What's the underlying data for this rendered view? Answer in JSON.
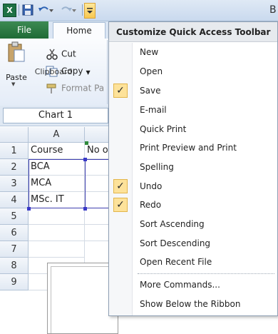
{
  "title_bar": {
    "app_title_partial": "B"
  },
  "ribbon": {
    "tabs": {
      "file": "File",
      "home": "Home"
    },
    "clipboard": {
      "paste": "Paste",
      "cut": "Cut",
      "copy": "Copy",
      "format_painter": "Format Pa",
      "group_label": "Clipboard"
    }
  },
  "name_box": {
    "value": "Chart 1"
  },
  "grid": {
    "columns": [
      "A"
    ],
    "rows": [
      "1",
      "2",
      "3",
      "4",
      "5",
      "6",
      "7",
      "8",
      "9"
    ],
    "cells": {
      "A1": "Course",
      "B1": "No o",
      "A2": "BCA",
      "A3": "MCA",
      "A4": "MSc. IT"
    }
  },
  "qat_menu": {
    "header": "Customize Quick Access Toolbar",
    "items": [
      {
        "label": "New",
        "checked": false
      },
      {
        "label": "Open",
        "checked": false
      },
      {
        "label": "Save",
        "checked": true
      },
      {
        "label": "E-mail",
        "checked": false
      },
      {
        "label": "Quick Print",
        "checked": false
      },
      {
        "label": "Print Preview and Print",
        "checked": false
      },
      {
        "label": "Spelling",
        "checked": false
      },
      {
        "label": "Undo",
        "checked": true
      },
      {
        "label": "Redo",
        "checked": true
      },
      {
        "label": "Sort Ascending",
        "checked": false
      },
      {
        "label": "Sort Descending",
        "checked": false
      },
      {
        "label": "Open Recent File",
        "checked": false
      },
      {
        "label": "More Commands...",
        "checked": false
      },
      {
        "label": "Show Below the Ribbon",
        "checked": false
      }
    ],
    "check_glyph": "✓"
  },
  "colors": {
    "file_tab": "#1f6b36",
    "check_highlight": "#fde29a",
    "selection_border": "#3f3fb0"
  },
  "icons": [
    "excel-icon",
    "save-icon",
    "undo-icon",
    "redo-icon",
    "customize-dropdown-icon",
    "paste-icon",
    "cut-icon",
    "copy-icon",
    "format-painter-icon",
    "check-icon"
  ]
}
